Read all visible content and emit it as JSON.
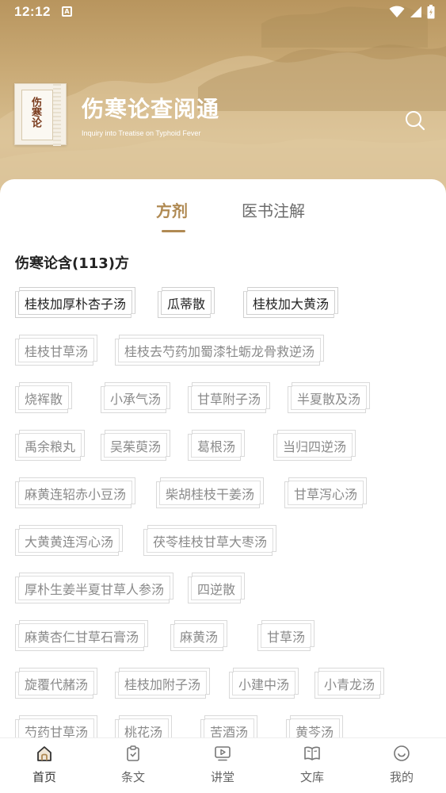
{
  "status_bar": {
    "time": "12:12",
    "notification_icon": "A"
  },
  "header": {
    "logo_text": "伤寒论",
    "title": "伤寒论查阅通",
    "subtitle": "Inquiry into Treatise on Typhoid Fever"
  },
  "tabs": [
    {
      "label": "方剂",
      "active": true
    },
    {
      "label": "医书注解",
      "active": false
    }
  ],
  "section": {
    "title": "伤寒论含(113)方"
  },
  "chips": [
    "桂枝加厚朴杏子汤",
    "瓜蒂散",
    "桂枝加大黄汤",
    "桂枝甘草汤",
    "桂枝去芍药加蜀漆牡蛎龙骨救逆汤",
    "烧裈散",
    "小承气汤",
    "甘草附子汤",
    "半夏散及汤",
    "禹余粮丸",
    "吴茱萸汤",
    "葛根汤",
    "当归四逆汤",
    "麻黄连轺赤小豆汤",
    "柴胡桂枝干姜汤",
    "甘草泻心汤",
    "大黄黄连泻心汤",
    "茯苓桂枝甘草大枣汤",
    "厚朴生姜半夏甘草人参汤",
    "四逆散",
    "麻黄杏仁甘草石膏汤",
    "麻黄汤",
    "甘草汤",
    "旋覆代赭汤",
    "桂枝加附子汤",
    "小建中汤",
    "小青龙汤",
    "芍药甘草汤",
    "桃花汤",
    "苦酒汤",
    "黄芩汤"
  ],
  "bottom_nav": [
    {
      "label": "首页",
      "icon": "home-icon",
      "active": true
    },
    {
      "label": "条文",
      "icon": "clipboard-icon",
      "active": false
    },
    {
      "label": "讲堂",
      "icon": "video-play-icon",
      "active": false
    },
    {
      "label": "文库",
      "icon": "book-icon",
      "active": false
    },
    {
      "label": "我的",
      "icon": "smile-icon",
      "active": false
    }
  ],
  "colors": {
    "accent": "#b08a53",
    "header_bg": "#c9aa76"
  }
}
